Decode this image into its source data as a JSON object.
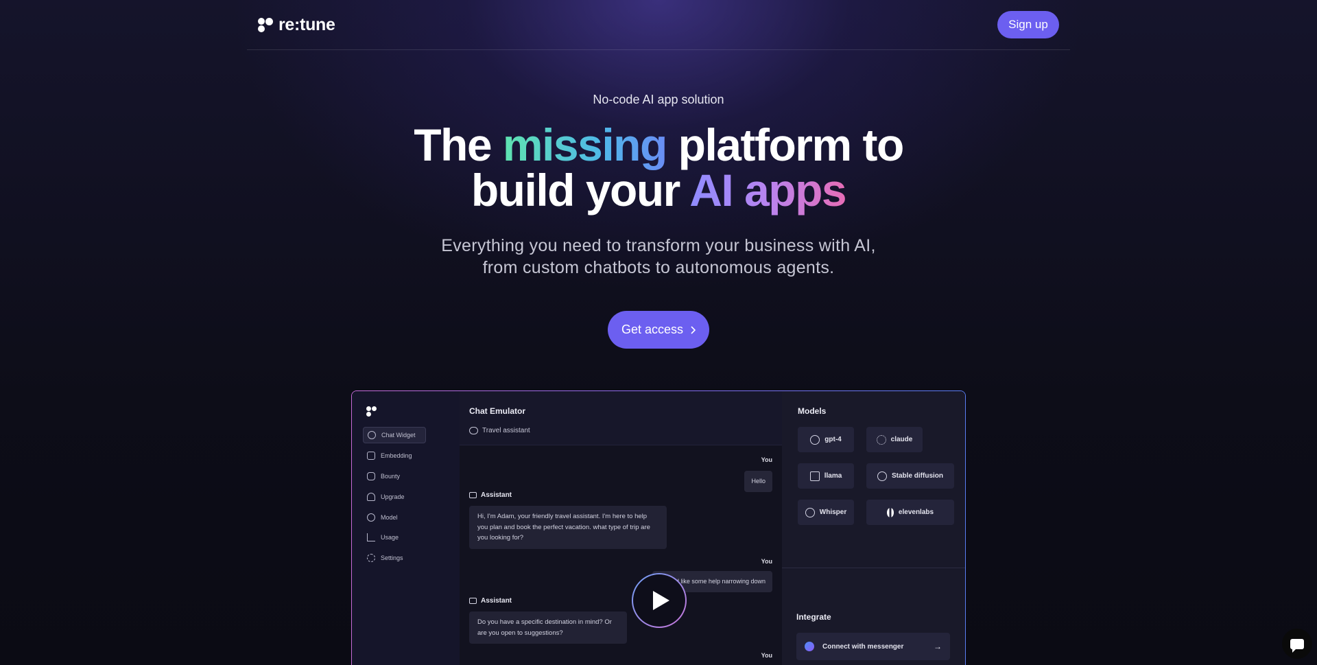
{
  "header": {
    "logo_text": "re:tune",
    "signup_label": "Sign up"
  },
  "hero": {
    "eyebrow": "No-code AI app solution",
    "headline": {
      "part1": "The ",
      "highlight1": "missing",
      "part2": " platform to",
      "part3": "build your ",
      "highlight2": "AI apps"
    },
    "subhead_line1": "Everything you need to transform your business with AI,",
    "subhead_line2": "from custom chatbots to autonomous agents.",
    "cta_label": "Get access",
    "cta_icon": "chevron-right-icon"
  },
  "preview": {
    "sidebar": {
      "items": [
        {
          "label": "Chat Widget",
          "icon": "chat-icon",
          "active": true
        },
        {
          "label": "Embedding",
          "icon": "embedding-icon"
        },
        {
          "label": "Bounty",
          "icon": "bounty-icon"
        },
        {
          "label": "Upgrade",
          "icon": "rocket-icon"
        },
        {
          "label": "Model",
          "icon": "model-icon"
        },
        {
          "label": "Usage",
          "icon": "chart-icon"
        },
        {
          "label": "Settings",
          "icon": "gear-icon"
        }
      ]
    },
    "chat": {
      "title": "Chat Emulator",
      "subtitle": "Travel assistant",
      "you_label": "You",
      "assistant_label": "Assistant",
      "messages": [
        {
          "from": "You",
          "text": "Hello"
        },
        {
          "from": "Assistant",
          "text": "Hi, I'm Adam, your friendly travel assistant. I'm here to help you plan and book the perfect vacation. what type of trip are you looking for?"
        },
        {
          "from": "You",
          "text": "I would like some help narrowing down"
        },
        {
          "from": "Assistant",
          "text": "Do you have a specific destination in mind? Or are you open to suggestions?"
        },
        {
          "from": "You",
          "text": ""
        }
      ]
    },
    "models": {
      "title": "Models",
      "items": [
        "gpt-4",
        "claude",
        "llama",
        "Stable diffusion",
        "Whisper",
        "elevenlabs"
      ]
    },
    "integrate": {
      "title": "Integrate",
      "connect_label": "Connect with messenger",
      "arrow": "→"
    }
  },
  "colors": {
    "accent": "#6c5ff0",
    "background": "#0b0b14"
  }
}
